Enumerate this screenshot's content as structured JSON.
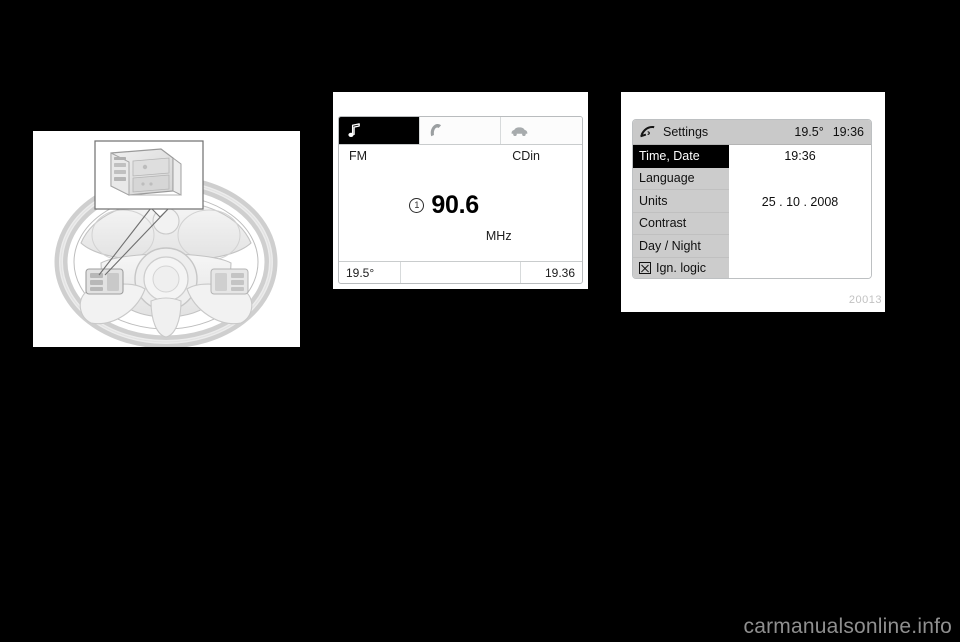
{
  "page": {
    "background_color": "#000000",
    "watermark": "carmanualsonline.info"
  },
  "steering_figure": {
    "name": "steering-wheel-audio-controls",
    "description": "Steering wheel with left-hand audio control buttons and magnified inset callout"
  },
  "radio_display": {
    "tabs": [
      {
        "icon": "music-note-icon",
        "selected": true
      },
      {
        "icon": "phone-handset-icon",
        "selected": false
      },
      {
        "icon": "car-icon",
        "selected": false
      }
    ],
    "source_label": "FM",
    "secondary_label": "CDin",
    "preset_number": "1",
    "frequency": "90.6",
    "frequency_unit": "MHz",
    "status": {
      "temperature": "19.5°",
      "middle": "",
      "time": "19.36"
    }
  },
  "settings_display": {
    "header": {
      "icon": "wrench-icon",
      "title": "Settings",
      "temperature": "19.5°",
      "time": "19:36"
    },
    "menu_items": [
      {
        "label": "Time, Date",
        "selected": true,
        "checkbox": false
      },
      {
        "label": "Language",
        "selected": false,
        "checkbox": false
      },
      {
        "label": "Units",
        "selected": false,
        "checkbox": false
      },
      {
        "label": "Contrast",
        "selected": false,
        "checkbox": false
      },
      {
        "label": "Day / Night",
        "selected": false,
        "checkbox": false
      },
      {
        "label": "Ign. logic",
        "selected": false,
        "checkbox": true
      }
    ],
    "values": {
      "time": "19:36",
      "date": "25 . 10 . 2008"
    },
    "figure_id": "20013"
  }
}
